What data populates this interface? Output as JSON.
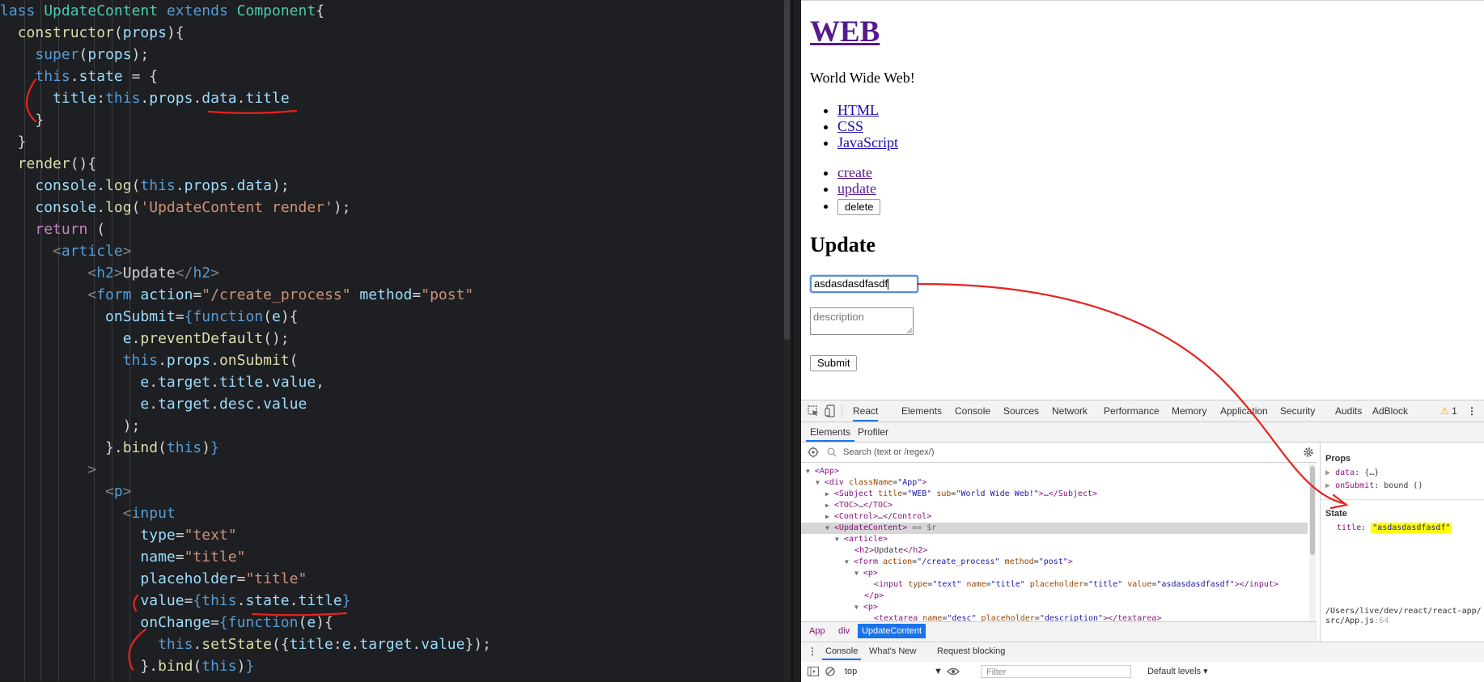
{
  "editor": {
    "lines": [
      "<span class=\"k\">lass</span> <span class=\"cl\">UpdateContent</span> <span class=\"k\">extends</span> <span class=\"cl\">Component</span>{",
      "  <span class=\"fn\">constructor</span>(<span class=\"pr\">props</span>){",
      "    <span class=\"k\">super</span>(<span class=\"pr\">props</span>);",
      "    <span class=\"k\">this</span>.<span class=\"pr\">state</span> = {",
      "      <span class=\"pr\">title</span>:<span class=\"k\">this</span>.<span class=\"pr\">props</span>.<span class=\"pr\">data</span>.<span class=\"pr\">title</span>",
      "    }",
      "  }",
      "  <span class=\"fn\">render</span>(){",
      "    <span class=\"pr\">console</span>.<span class=\"fn\">log</span>(<span class=\"k\">this</span>.<span class=\"pr\">props</span>.<span class=\"pr\">data</span>);",
      "    <span class=\"pr\">console</span>.<span class=\"fn\">log</span>(<span class=\"st\">'UpdateContent render'</span>);",
      "    <span class=\"kf\">return</span> (",
      "      <span class=\"tg\">&lt;</span><span class=\"tn\">article</span><span class=\"tg\">&gt;</span>",
      "          <span class=\"tg\">&lt;</span><span class=\"tn\">h2</span><span class=\"tg\">&gt;</span>Update<span class=\"tg\">&lt;/</span><span class=\"tn\">h2</span><span class=\"tg\">&gt;</span>",
      "          <span class=\"tg\">&lt;</span><span class=\"tn\">form</span> <span class=\"pr\">action</span>=<span class=\"st\">\"/create_process\"</span> <span class=\"pr\">method</span>=<span class=\"st\">\"post\"</span>",
      "            <span class=\"pr\">onSubmit</span>=<span class=\"k\">{function</span>(<span class=\"pr\">e</span>){",
      "              <span class=\"pr\">e</span>.<span class=\"fn\">preventDefault</span>();",
      "              <span class=\"k\">this</span>.<span class=\"pr\">props</span>.<span class=\"fn\">onSubmit</span>(",
      "                <span class=\"pr\">e</span>.<span class=\"pr\">target</span>.<span class=\"pr\">title</span>.<span class=\"pr\">value</span>,",
      "                <span class=\"pr\">e</span>.<span class=\"pr\">target</span>.<span class=\"pr\">desc</span>.<span class=\"pr\">value</span>",
      "              );",
      "            }.<span class=\"fn\">bind</span>(<span class=\"k\">this</span>)<span class=\"k\">}</span>",
      "          <span class=\"tg\">&gt;</span>",
      "            <span class=\"tg\">&lt;</span><span class=\"tn\">p</span><span class=\"tg\">&gt;</span>",
      "              <span class=\"tg\">&lt;</span><span class=\"tn\">input</span>",
      "                <span class=\"pr\">type</span>=<span class=\"st\">\"text\"</span>",
      "                <span class=\"pr\">name</span>=<span class=\"st\">\"title\"</span>",
      "                <span class=\"pr\">placeholder</span>=<span class=\"st\">\"title\"</span>",
      "                <span class=\"pr\">value</span>=<span class=\"k\">{this</span>.<span class=\"pr\">state</span>.<span class=\"pr\">title</span><span class=\"k\">}</span>",
      "                <span class=\"pr\">onChange</span>=<span class=\"k\">{function</span>(<span class=\"pr\">e</span>){",
      "                  <span class=\"k\">this</span>.<span class=\"fn\">setState</span>({<span class=\"pr\">title</span>:<span class=\"pr\">e</span>.<span class=\"pr\">target</span>.<span class=\"pr\">value</span>});",
      "                }.<span class=\"fn\">bind</span>(<span class=\"k\">this</span>)<span class=\"k\">}</span>"
    ]
  },
  "browser": {
    "heading": "WEB",
    "subtitle": "World Wide Web!",
    "nav": [
      "HTML",
      "CSS",
      "JavaScript"
    ],
    "controls": {
      "create": "create",
      "update": "update",
      "delete": "delete"
    },
    "section_title": "Update",
    "title_value": "asdasdasdfasdf",
    "desc_placeholder": "description",
    "submit_label": "Submit"
  },
  "devtools": {
    "tabs": [
      "React",
      "Elements",
      "Console",
      "Sources",
      "Network",
      "Performance",
      "Memory",
      "Application",
      "Security",
      "Audits",
      "AdBlock"
    ],
    "active_tab": "React",
    "warning_count": "1",
    "subtabs": [
      "Elements",
      "Profiler"
    ],
    "search_placeholder": "Search (text or /regex/)",
    "tree": [
      {
        "indent": 0,
        "arrow": "▼",
        "html": "<span class=\"tg2\">&lt;App&gt;</span>"
      },
      {
        "indent": 1,
        "arrow": "▼",
        "html": "<span class=\"tg2\">&lt;div</span> <span class=\"an\">className</span>=<span class=\"av\">\"App\"</span><span class=\"tg2\">&gt;</span>"
      },
      {
        "indent": 2,
        "arrow": "▶",
        "html": "<span class=\"tg2\">&lt;Subject</span> <span class=\"an\">title</span>=<span class=\"av\">\"WEB\"</span> <span class=\"an\">sub</span>=<span class=\"av\">\"World Wide Web!\"</span><span class=\"tg2\">&gt;</span>…<span class=\"tg2\">&lt;/Subject&gt;</span>"
      },
      {
        "indent": 2,
        "arrow": "▶",
        "html": "<span class=\"tg2\">&lt;TOC&gt;</span>…<span class=\"tg2\">&lt;/TOC&gt;</span>"
      },
      {
        "indent": 2,
        "arrow": "▶",
        "html": "<span class=\"tg2\">&lt;Control&gt;</span>…<span class=\"tg2\">&lt;/Control&gt;</span>"
      },
      {
        "indent": 2,
        "arrow": "▼",
        "html": "<span class=\"tg2\">&lt;UpdateContent&gt;</span> <span class=\"ar\">== $r</span>",
        "selected": true
      },
      {
        "indent": 3,
        "arrow": "▼",
        "html": "<span class=\"tg2\">&lt;article&gt;</span>"
      },
      {
        "indent": 4,
        "arrow": "",
        "html": "<span class=\"tg2\">&lt;h2&gt;</span>Update<span class=\"tg2\">&lt;/h2&gt;</span>"
      },
      {
        "indent": 4,
        "arrow": "▼",
        "html": "<span class=\"tg2\">&lt;form</span> <span class=\"an\">action</span>=<span class=\"av\">\"/create_process\"</span> <span class=\"an\">method</span>=<span class=\"av\">\"post\"</span><span class=\"tg2\">&gt;</span>"
      },
      {
        "indent": 5,
        "arrow": "▼",
        "html": "<span class=\"tg2\">&lt;p&gt;</span>"
      },
      {
        "indent": 6,
        "arrow": "",
        "html": "<span class=\"tg2\">&lt;input</span> <span class=\"an\">type</span>=<span class=\"av\">\"text\"</span> <span class=\"an\">name</span>=<span class=\"av\">\"title\"</span> <span class=\"an\">placeholder</span>=<span class=\"av\">\"title\"</span> <span class=\"an\">value</span>=<span class=\"av\">\"asdasdasdfasdf\"</span><span class=\"tg2\">&gt;&lt;/input&gt;</span>"
      },
      {
        "indent": 5,
        "arrow": "",
        "html": "<span class=\"tg2\">&lt;/p&gt;</span>"
      },
      {
        "indent": 5,
        "arrow": "▼",
        "html": "<span class=\"tg2\">&lt;p&gt;</span>"
      },
      {
        "indent": 6,
        "arrow": "",
        "html": "<span class=\"tg2\">&lt;textarea</span> <span class=\"an\">name</span>=<span class=\"av\">\"desc\"</span> <span class=\"an\">placeholder</span>=<span class=\"av\">\"description\"</span><span class=\"tg2\">&gt;&lt;/textarea&gt;</span>"
      }
    ],
    "props_heading": "Props",
    "props": [
      {
        "key": "data",
        "value": "{…}"
      },
      {
        "key": "onSubmit",
        "value": "bound ()"
      }
    ],
    "state_heading": "State",
    "state_key": "title",
    "state_value": "\"asdasdasdfasdf\"",
    "source_path": "/Users/live/dev/react/react-app/src/App.js",
    "source_line": ":64",
    "breadcrumbs": [
      "App",
      "div",
      "UpdateContent"
    ],
    "drawer_tabs": [
      "Console",
      "What's New",
      "Request blocking"
    ],
    "context": "top",
    "filter_placeholder": "Filter",
    "levels": "Default levels ▾"
  },
  "colors": {
    "annotation": "#e8231e",
    "highlight": "#ffff00",
    "active_tab_underline": "#1a73e8",
    "breadcrumb_active": "#1a73e8"
  }
}
